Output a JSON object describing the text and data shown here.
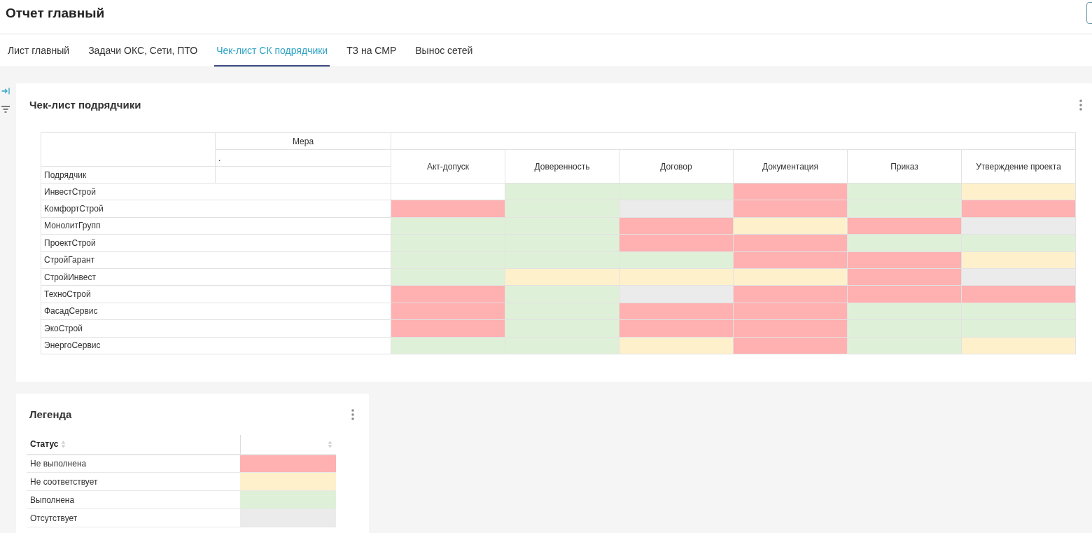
{
  "header": {
    "title": "Отчет главный"
  },
  "tabs": [
    {
      "label": "Лист главный",
      "selected": false
    },
    {
      "label": "Задачи ОКС, Сети, ПТО",
      "selected": false
    },
    {
      "label": "Чек-лист СК подрядчики",
      "selected": true
    },
    {
      "label": "ТЗ на СМР",
      "selected": false
    },
    {
      "label": "Вынос сетей",
      "selected": false
    }
  ],
  "checklist_panel": {
    "title": "Чек-лист подрядчики",
    "measure_header": "Мера",
    "measure_subheader": ".",
    "row_header": "Подрядчик",
    "columns": [
      "Акт-допуск",
      "Доверенность",
      "Договор",
      "Документация",
      "Приказ",
      "Утверждение проекта"
    ],
    "rows": [
      {
        "name": "ИнвестСтрой",
        "cells": [
          {
            "color": "#ffffff"
          },
          {
            "color": "#dff0d8"
          },
          {
            "color": "#dff0d8"
          },
          {
            "color": "#ffb0b0"
          },
          {
            "color": "#dff0d8"
          },
          {
            "color": "#fff0cc"
          }
        ]
      },
      {
        "name": "КомфортСтрой",
        "cells": [
          {
            "color": "#ffb0b0"
          },
          {
            "color": "#dff0d8"
          },
          {
            "color": "#ebebeb"
          },
          {
            "color": "#ffb0b0"
          },
          {
            "color": "#dff0d8"
          },
          {
            "color": "#ffb0b0"
          }
        ]
      },
      {
        "name": "МонолитГрупп",
        "cells": [
          {
            "color": "#dff0d8"
          },
          {
            "color": "#dff0d8"
          },
          {
            "color": "#ffb0b0"
          },
          {
            "color": "#fff0cc"
          },
          {
            "color": "#ffb0b0"
          },
          {
            "color": "#ebebeb"
          }
        ]
      },
      {
        "name": "ПроектСтрой",
        "cells": [
          {
            "color": "#dff0d8"
          },
          {
            "color": "#dff0d8"
          },
          {
            "color": "#ffb0b0"
          },
          {
            "color": "#ffb0b0"
          },
          {
            "color": "#dff0d8"
          },
          {
            "color": "#dff0d8"
          }
        ]
      },
      {
        "name": "СтройГарант",
        "cells": [
          {
            "color": "#dff0d8"
          },
          {
            "color": "#dff0d8"
          },
          {
            "color": "#dff0d8"
          },
          {
            "color": "#ffb0b0"
          },
          {
            "color": "#ffb0b0"
          },
          {
            "color": "#fff0cc"
          }
        ]
      },
      {
        "name": "СтройИнвест",
        "cells": [
          {
            "color": "#dff0d8"
          },
          {
            "color": "#fff0cc"
          },
          {
            "color": "#fff0cc"
          },
          {
            "color": "#fff0cc"
          },
          {
            "color": "#ffb0b0"
          },
          {
            "color": "#ebebeb"
          }
        ]
      },
      {
        "name": "ТехноСтрой",
        "cells": [
          {
            "color": "#ffb0b0"
          },
          {
            "color": "#dff0d8"
          },
          {
            "color": "#ebebeb"
          },
          {
            "color": "#ffb0b0"
          },
          {
            "color": "#ffb0b0"
          },
          {
            "color": "#ffb0b0"
          }
        ]
      },
      {
        "name": "ФасадСервис",
        "cells": [
          {
            "color": "#ffb0b0"
          },
          {
            "color": "#dff0d8"
          },
          {
            "color": "#ffb0b0"
          },
          {
            "color": "#ffb0b0"
          },
          {
            "color": "#dff0d8"
          },
          {
            "color": "#dff0d8"
          }
        ]
      },
      {
        "name": "ЭкоСтрой",
        "cells": [
          {
            "color": "#ffb0b0"
          },
          {
            "color": "#dff0d8"
          },
          {
            "color": "#ffb0b0"
          },
          {
            "color": "#ffb0b0"
          },
          {
            "color": "#dff0d8"
          },
          {
            "color": "#dff0d8"
          }
        ]
      },
      {
        "name": "ЭнергоСервис",
        "cells": [
          {
            "color": "#dff0d8"
          },
          {
            "color": "#dff0d8"
          },
          {
            "color": "#fff0cc"
          },
          {
            "color": "#ffb0b0"
          },
          {
            "color": "#dff0d8"
          },
          {
            "color": "#fff0cc"
          }
        ]
      }
    ]
  },
  "legend_panel": {
    "title": "Легенда",
    "status_header": "Статус",
    "rows": [
      {
        "label": "Не выполнена",
        "color": "#ffb0b0"
      },
      {
        "label": "Не соответствует",
        "color": "#fff0cc"
      },
      {
        "label": "Выполнена",
        "color": "#dff0d8"
      },
      {
        "label": "Отсутствует",
        "color": "#ebebeb"
      }
    ]
  }
}
